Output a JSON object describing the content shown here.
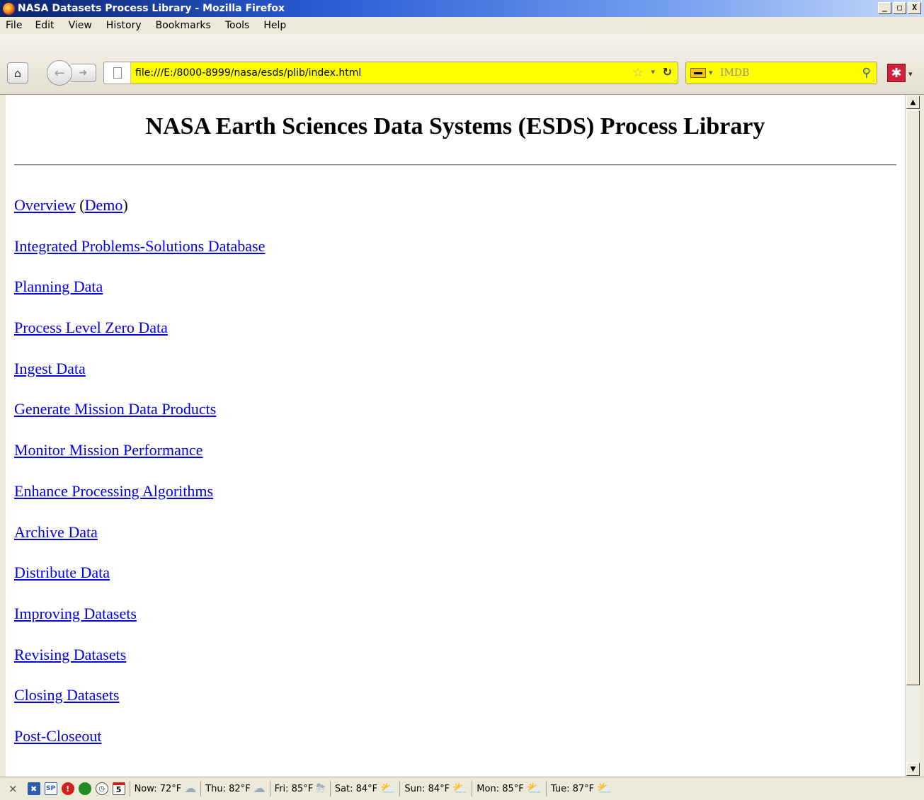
{
  "window": {
    "title": "NASA Datasets Process Library - Mozilla Firefox",
    "controls": [
      "_",
      "□",
      "X"
    ]
  },
  "menubar": {
    "items": [
      "File",
      "Edit",
      "View",
      "History",
      "Bookmarks",
      "Tools",
      "Help"
    ]
  },
  "navbar": {
    "url": "file:///E:/8000-8999/nasa/esds/plib/index.html",
    "search_placeholder": "IMDB"
  },
  "page": {
    "heading": "NASA Earth Sciences Data Systems (ESDS) Process Library",
    "links": {
      "overview": "Overview",
      "demo": "Demo",
      "items": [
        "Integrated Problems-Solutions Database",
        "Planning Data",
        "Process Level Zero Data",
        "Ingest Data",
        "Generate Mission Data Products",
        "Monitor Mission Performance",
        "Enhance Processing Algorithms",
        "Archive Data",
        "Distribute Data",
        "Improving Datasets",
        "Revising Datasets",
        "Closing Datasets",
        "Post-Closeout"
      ]
    }
  },
  "statusbar": {
    "icons": [
      "close-icon",
      "xmarks-icon",
      "sp-icon",
      "alert-icon",
      "green-globe-icon",
      "clock-icon",
      "calendar-icon"
    ],
    "calendar_day": "5",
    "sp_label": "SP",
    "weather": [
      {
        "label": "Now: 72°F",
        "icon": "cloud-icon"
      },
      {
        "label": "Thu: 82°F",
        "icon": "rain-cloud-icon"
      },
      {
        "label": "Fri: 85°F",
        "icon": "storm-cloud-icon"
      },
      {
        "label": "Sat: 84°F",
        "icon": "partly-sunny-icon"
      },
      {
        "label": "Sun: 84°F",
        "icon": "partly-sunny-icon"
      },
      {
        "label": "Mon: 85°F",
        "icon": "partly-sunny-icon"
      },
      {
        "label": "Tue: 87°F",
        "icon": "partly-sunny-icon"
      }
    ]
  },
  "colors": {
    "link": "#0000ee",
    "url_bar_bg": "#ffff00",
    "titlebar_start": "#0a246a"
  }
}
